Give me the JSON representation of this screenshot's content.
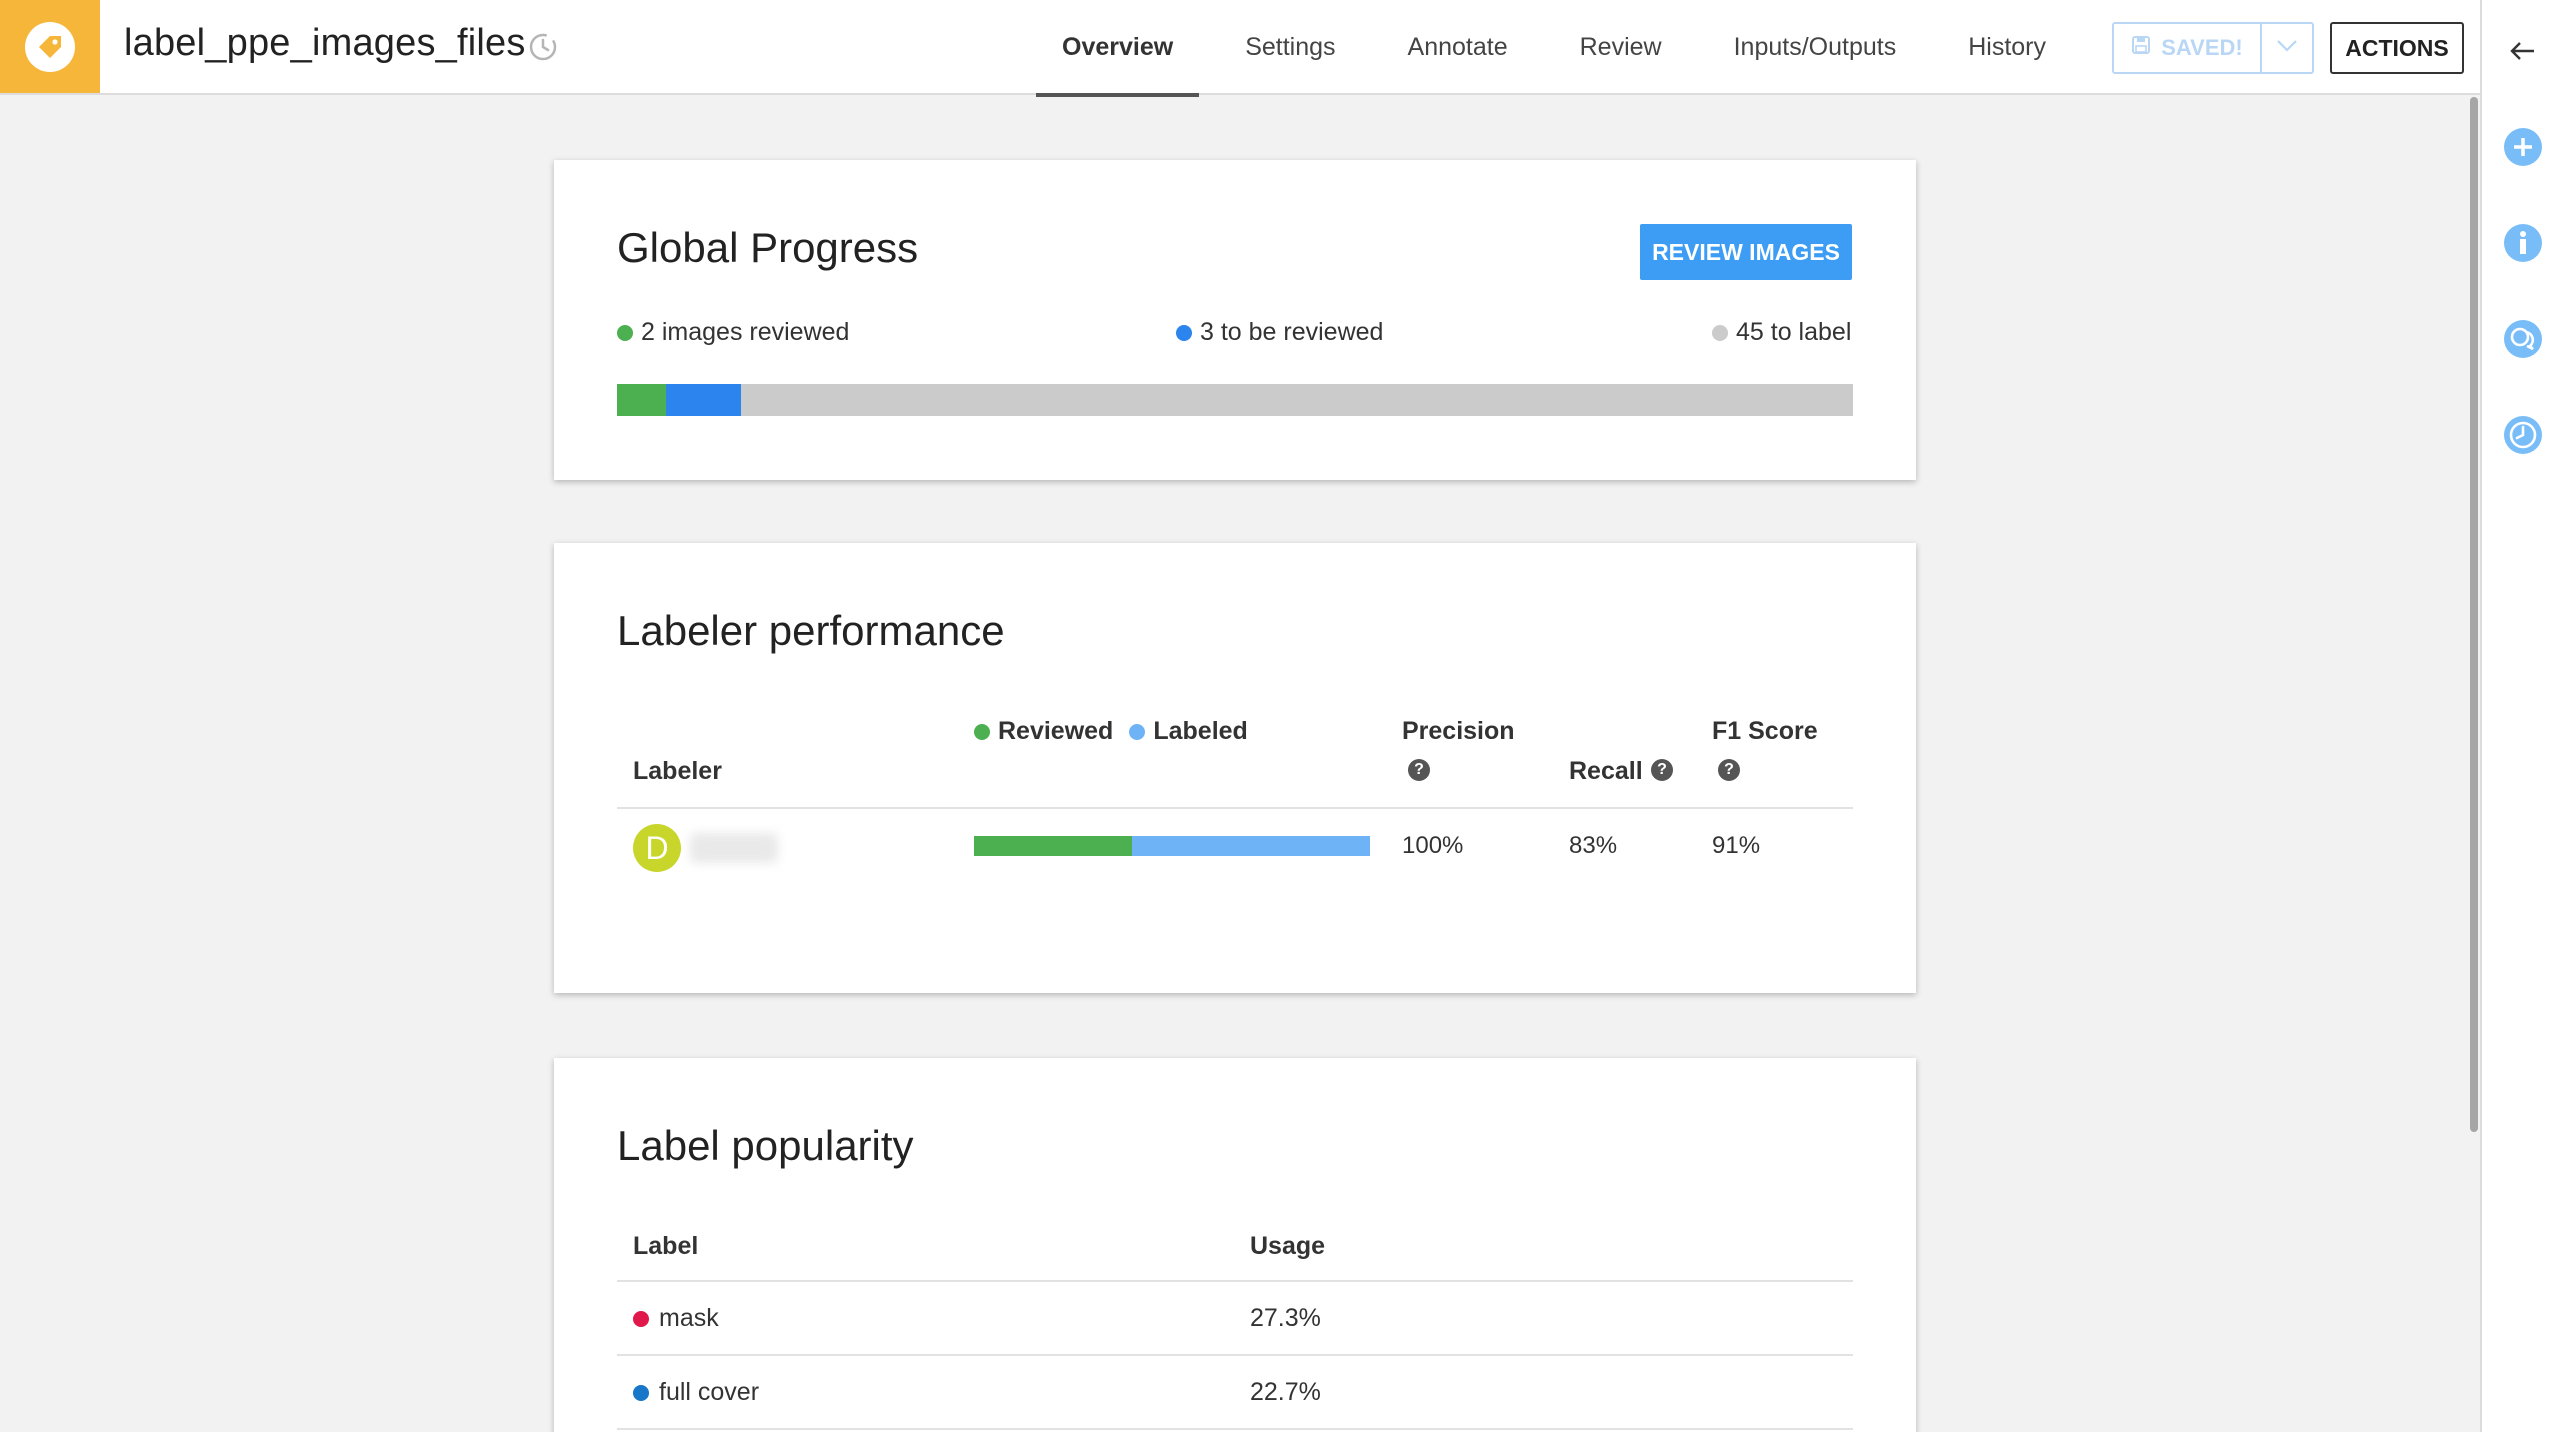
{
  "header": {
    "title": "label_ppe_images_files",
    "tabs": [
      {
        "label": "Overview",
        "active": true
      },
      {
        "label": "Settings",
        "active": false
      },
      {
        "label": "Annotate",
        "active": false
      },
      {
        "label": "Review",
        "active": false
      },
      {
        "label": "Inputs/Outputs",
        "active": false
      },
      {
        "label": "History",
        "active": false
      }
    ],
    "saved_label": "SAVED!",
    "actions_label": "ACTIONS"
  },
  "global_progress": {
    "title": "Global Progress",
    "review_button": "REVIEW IMAGES",
    "legend": {
      "reviewed": "2 images reviewed",
      "to_review": "3 to be reviewed",
      "to_label": "45 to label"
    },
    "counts": {
      "reviewed": 2,
      "to_review": 3,
      "to_label": 45
    },
    "colors": {
      "reviewed": "#4caf50",
      "to_review": "#2c84ee",
      "to_label": "#cbcbcb"
    }
  },
  "labeler_performance": {
    "title": "Labeler performance",
    "columns": {
      "labeler": "Labeler",
      "reviewed": "Reviewed",
      "labeled": "Labeled",
      "precision": "Precision",
      "recall": "Recall",
      "f1": "F1 Score"
    },
    "rows": [
      {
        "avatar_letter": "D",
        "avatar_color": "#c8d62b",
        "reviewed_fraction": 0.4,
        "precision": "100%",
        "recall": "83%",
        "f1": "91%"
      }
    ],
    "colors": {
      "reviewed": "#4caf50",
      "labeled": "#6fb3f7"
    }
  },
  "label_popularity": {
    "title": "Label popularity",
    "columns": {
      "label": "Label",
      "usage": "Usage"
    },
    "rows": [
      {
        "label": "mask",
        "usage": "27.3%",
        "color": "#e0194a"
      },
      {
        "label": "full cover",
        "usage": "22.7%",
        "color": "#1877c9"
      }
    ]
  },
  "icons": {
    "app": "tag-icon",
    "title": "history-clock-icon",
    "rail": [
      "back-arrow-icon",
      "plus-circle-icon",
      "info-icon",
      "chat-icon",
      "clock-icon"
    ]
  }
}
